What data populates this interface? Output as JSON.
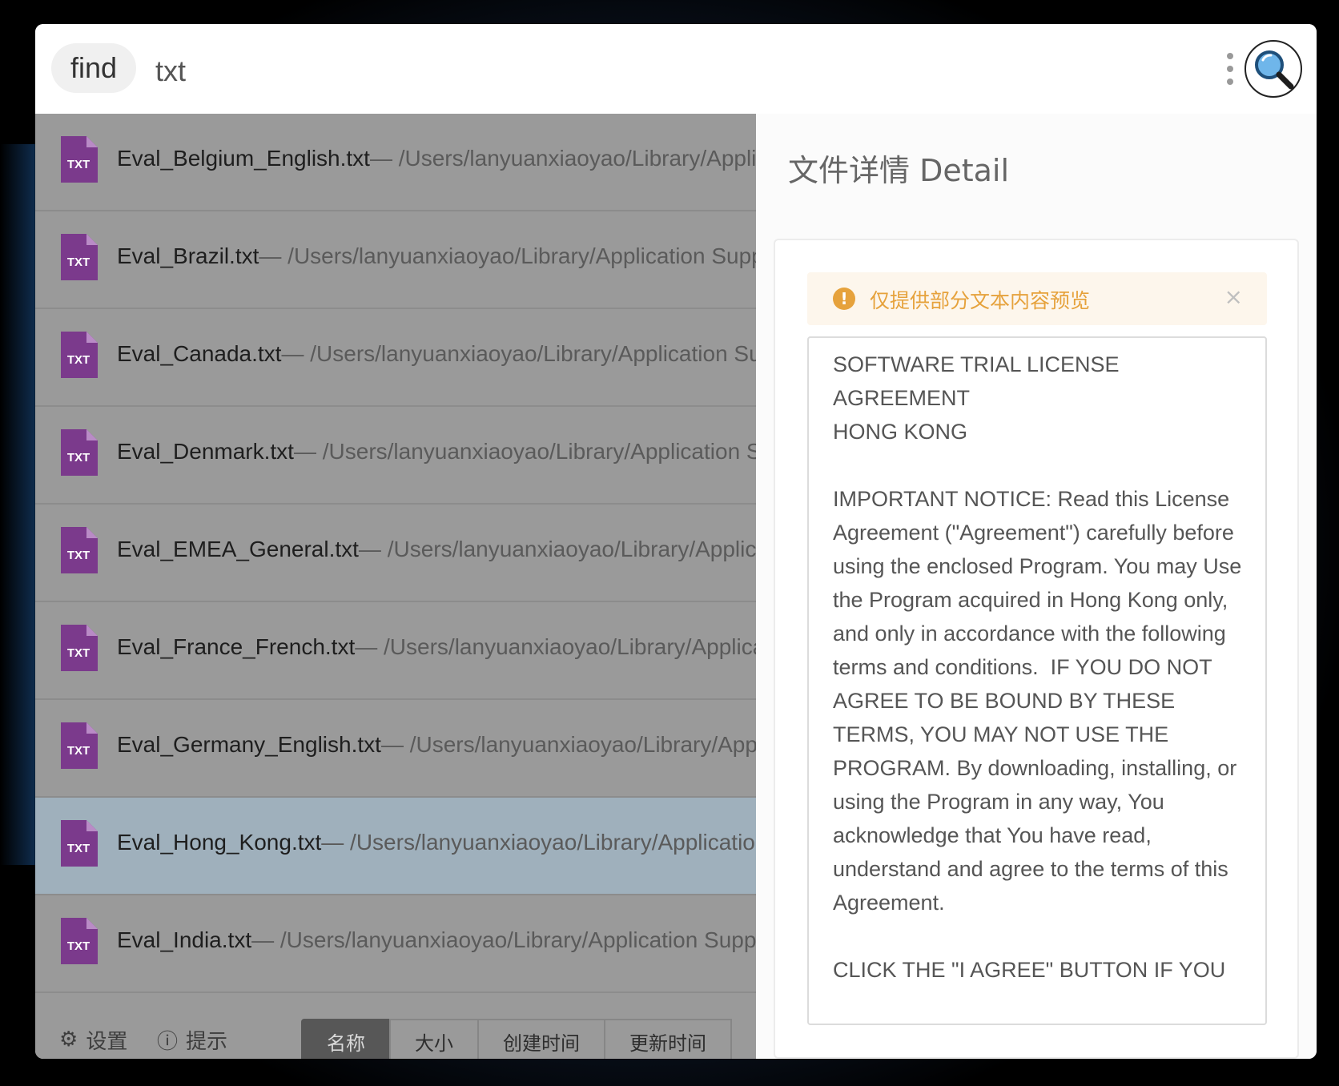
{
  "search": {
    "command": "find",
    "query": "txt"
  },
  "results": [
    {
      "name": "Eval_Belgium_English.txt",
      "path": "— /Users/lanyuanxiaoyao/Library/Application Support/",
      "selected": false
    },
    {
      "name": "Eval_Brazil.txt",
      "path": "— /Users/lanyuanxiaoyao/Library/Application Support/",
      "selected": false
    },
    {
      "name": "Eval_Canada.txt",
      "path": "— /Users/lanyuanxiaoyao/Library/Application Support/",
      "selected": false
    },
    {
      "name": "Eval_Denmark.txt",
      "path": "— /Users/lanyuanxiaoyao/Library/Application Support/",
      "selected": false
    },
    {
      "name": "Eval_EMEA_General.txt",
      "path": "— /Users/lanyuanxiaoyao/Library/Application Support/",
      "selected": false
    },
    {
      "name": "Eval_France_French.txt",
      "path": "— /Users/lanyuanxiaoyao/Library/Application Support/",
      "selected": false
    },
    {
      "name": "Eval_Germany_English.txt",
      "path": "— /Users/lanyuanxiaoyao/Library/Application Support/",
      "selected": false
    },
    {
      "name": "Eval_Hong_Kong.txt",
      "path": "— /Users/lanyuanxiaoyao/Library/Application Support/",
      "selected": true
    },
    {
      "name": "Eval_India.txt",
      "path": "— /Users/lanyuanxiaoyao/Library/Application Support/",
      "selected": false
    }
  ],
  "file_icon_label": "TXT",
  "footer": {
    "settings_label": "设置",
    "tips_label": "提示",
    "sort": [
      "名称",
      "大小",
      "创建时间",
      "更新时间"
    ],
    "active_sort": "名称"
  },
  "detail": {
    "title": "文件详情 Detail",
    "notice": "仅提供部分文本内容预览",
    "close": "×",
    "preview_text": "SOFTWARE TRIAL LICENSE\nAGREEMENT\nHONG KONG\n\nIMPORTANT NOTICE: Read this License Agreement (\"Agreement\") carefully before using the enclosed Program. You may Use the Program acquired in Hong Kong only, and only in accordance with the following terms and conditions.  IF YOU DO NOT AGREE TO BE BOUND BY THESE TERMS, YOU MAY NOT USE THE PROGRAM. By downloading, installing, or using the Program in any way, You acknowledge that You have read, understand and agree to the terms of this Agreement.\n\nCLICK THE \"I AGREE\" BUTTON IF YOU"
  },
  "colors": {
    "file_icon": "#7b3a8c",
    "notice_accent": "#e6a23c",
    "selected_row": "#9fb0bc",
    "list_overlay": "#9a9a9a"
  }
}
